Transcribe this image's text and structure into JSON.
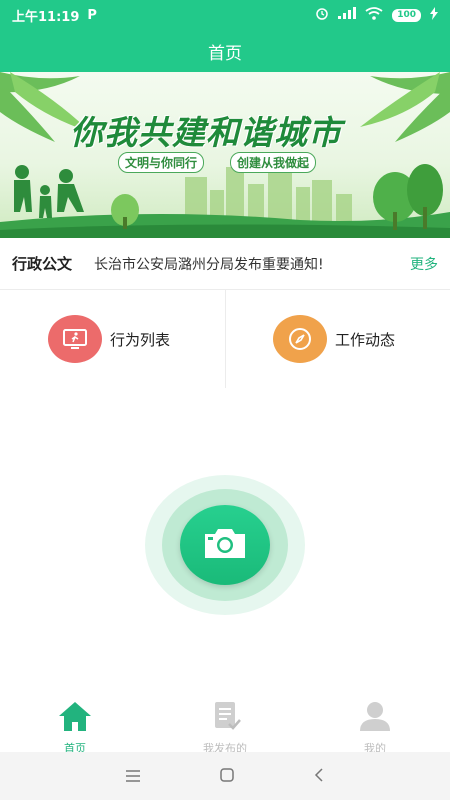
{
  "status": {
    "time": "上午11:19",
    "app_icon": "P",
    "battery": "100"
  },
  "header": {
    "title": "首页"
  },
  "banner": {
    "title": "你我共建和谐城市",
    "subtitle_left": "文明与你同行",
    "subtitle_right": "创建从我做起"
  },
  "notice": {
    "label": "行政公文",
    "text": "长治市公安局潞州分局发布重要通知!",
    "more": "更多"
  },
  "quick": {
    "items": [
      {
        "label": "行为列表",
        "icon": "behavior-list-icon"
      },
      {
        "label": "工作动态",
        "icon": "compass-icon"
      }
    ]
  },
  "tabs": [
    {
      "label": "首页",
      "icon": "home-icon"
    },
    {
      "label": "我发布的",
      "icon": "document-check-icon"
    },
    {
      "label": "我的",
      "icon": "user-icon"
    }
  ],
  "colors": {
    "primary": "#22c98a",
    "accent_red": "#ec6b6b",
    "accent_orange": "#f0a24b"
  }
}
